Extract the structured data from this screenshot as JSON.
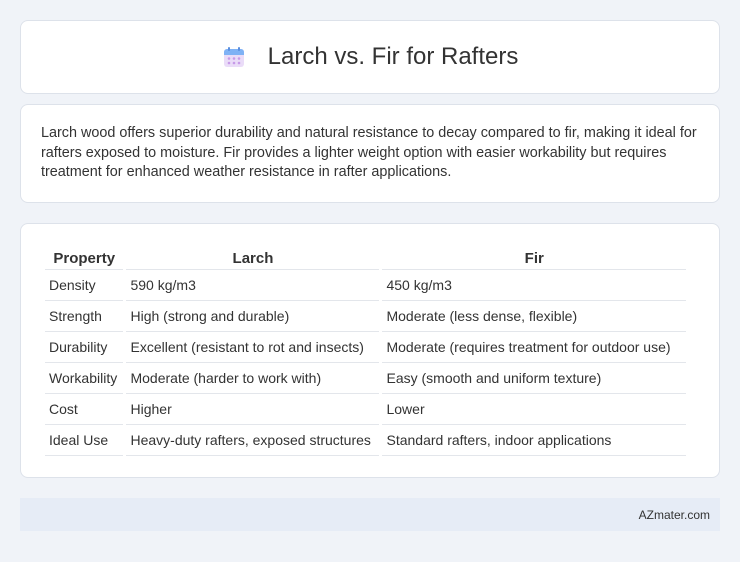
{
  "header": {
    "title": "Larch vs. Fir for Rafters",
    "icon": "calendar-icon",
    "icon_colors": {
      "top": "#7fb2f5",
      "body": "#e9d5f7",
      "dots": "#c79ae8"
    }
  },
  "summary": {
    "text": "Larch wood offers superior durability and natural resistance to decay compared to fir, making it ideal for rafters exposed to moisture. Fir provides a lighter weight option with easier workability but requires treatment for enhanced weather resistance in rafter applications."
  },
  "table": {
    "headers": [
      "Property",
      "Larch",
      "Fir"
    ],
    "rows": [
      [
        "Density",
        "590 kg/m3",
        "450 kg/m3"
      ],
      [
        "Strength",
        "High (strong and durable)",
        "Moderate (less dense, flexible)"
      ],
      [
        "Durability",
        "Excellent (resistant to rot and insects)",
        "Moderate (requires treatment for outdoor use)"
      ],
      [
        "Workability",
        "Moderate (harder to work with)",
        "Easy (smooth and uniform texture)"
      ],
      [
        "Cost",
        "Higher",
        "Lower"
      ],
      [
        "Ideal Use",
        "Heavy-duty rafters, exposed structures",
        "Standard rafters, indoor applications"
      ]
    ]
  },
  "footer": {
    "text": "AZmater.com"
  }
}
